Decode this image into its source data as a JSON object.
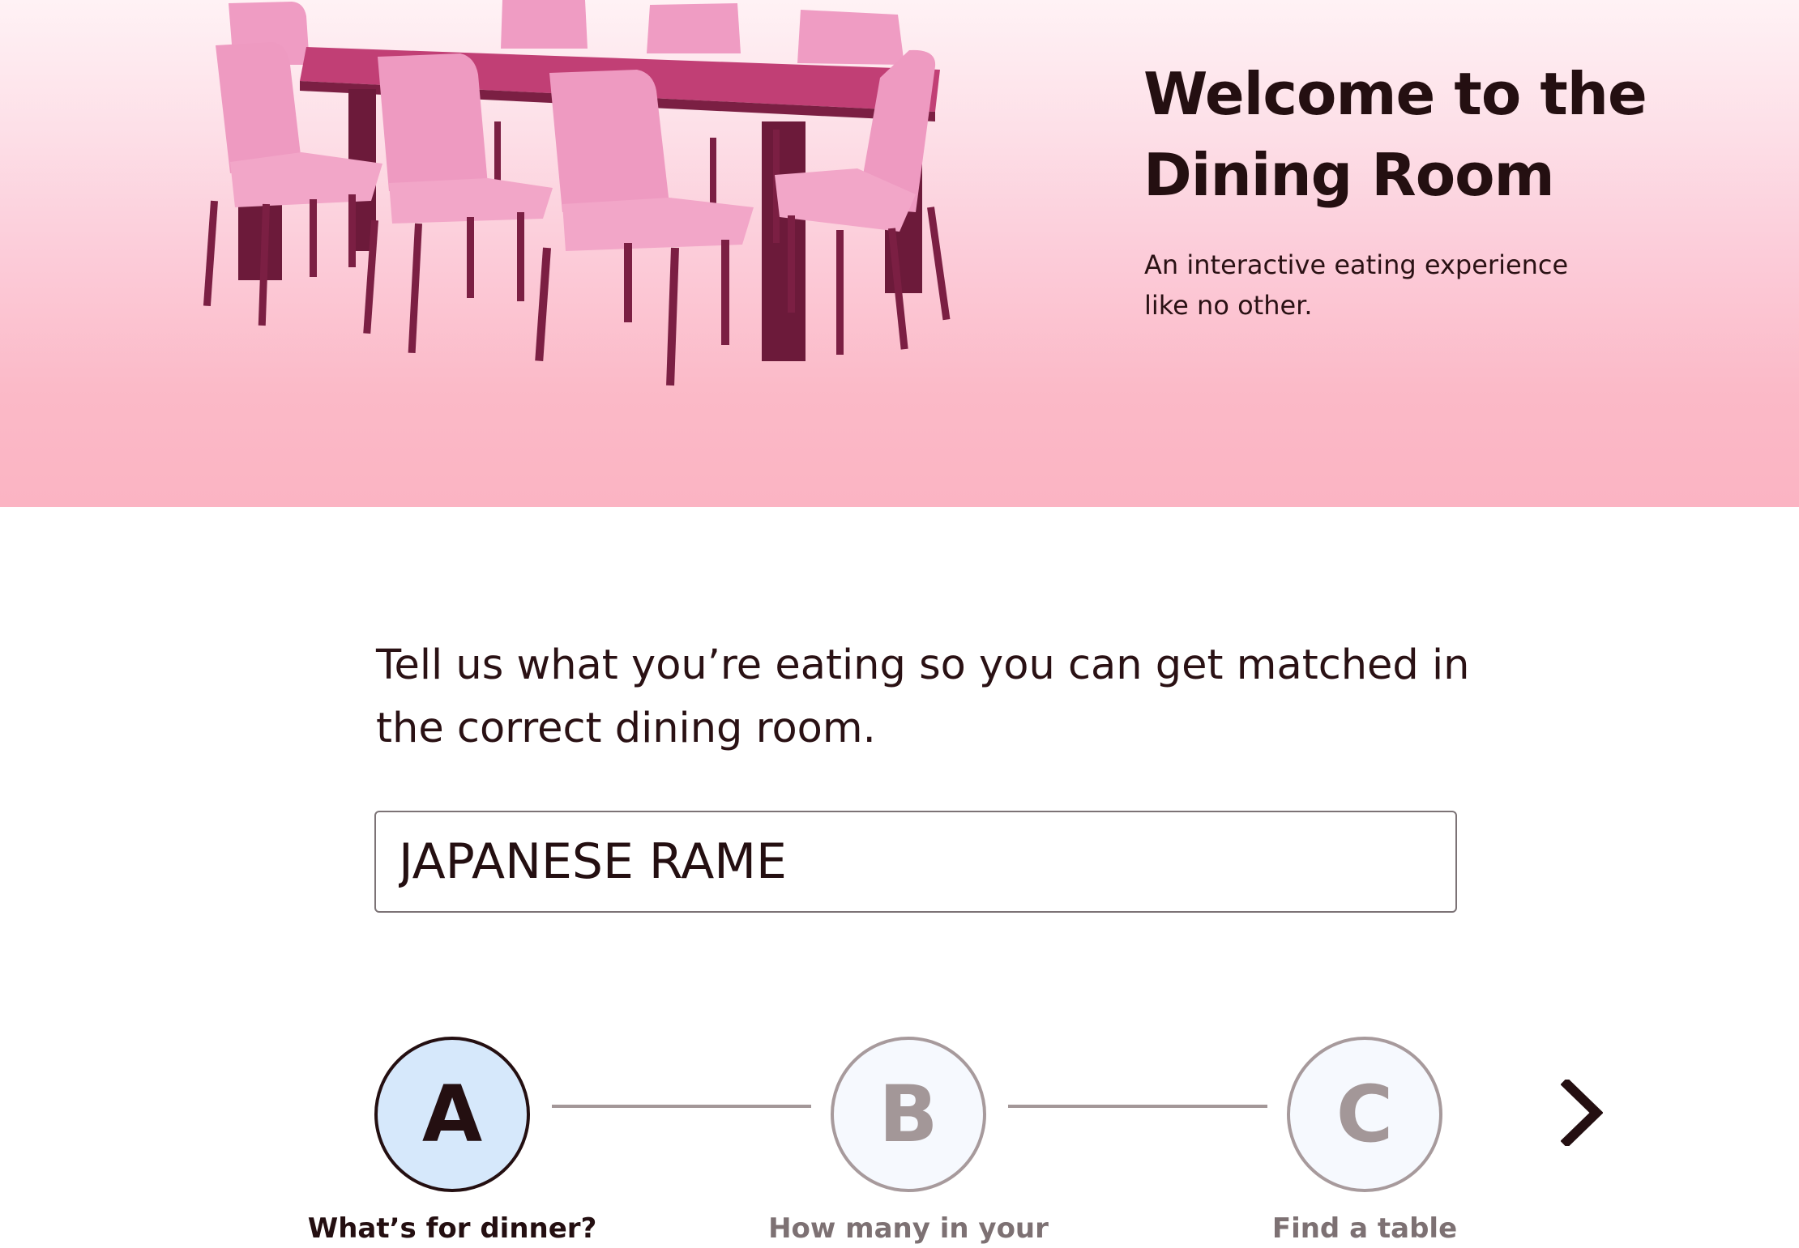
{
  "hero": {
    "title": "Welcome to the Dining Room",
    "subtitle": "An interactive eating experience like no other."
  },
  "form": {
    "prompt": "Tell us what you’re eating so you can get matched in the correct dining room.",
    "food_value": "JAPANESE RAME"
  },
  "stepper": {
    "steps": [
      {
        "letter": "A",
        "label": "What’s for dinner?",
        "state": "active"
      },
      {
        "letter": "B",
        "label": "How many in your",
        "state": "inactive"
      },
      {
        "letter": "C",
        "label": "Find a table",
        "state": "inactive"
      }
    ],
    "next_icon": "chevron-right-icon"
  },
  "colors": {
    "text_dark": "#240f11",
    "hero_top": "#fff2f5",
    "hero_bottom": "#fbb4c3",
    "furniture_pink": "#ee9cc1",
    "furniture_wood": "#7e2344",
    "active_step_fill": "#d6e8fb",
    "inactive_step": "#a39798"
  }
}
